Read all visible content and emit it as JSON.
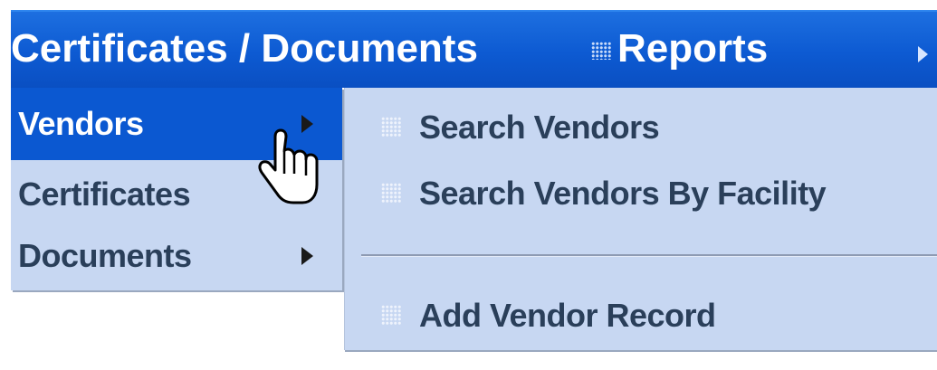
{
  "menubar": {
    "items": [
      {
        "label": "Certificates / Documents"
      },
      {
        "label": "Reports",
        "icon": "grip-icon"
      }
    ],
    "overflow_icon": "arrow-next-icon",
    "background_color": "#0b58d1",
    "text_color": "#ffffff"
  },
  "dropdown": {
    "items": [
      {
        "label": "Vendors",
        "selected": true,
        "has_submenu": true
      },
      {
        "label": "Certificates",
        "selected": false,
        "has_submenu": false
      },
      {
        "label": "Documents",
        "selected": false,
        "has_submenu": true
      }
    ],
    "background_color": "#c7d7f2",
    "selected_color": "#0b58d1"
  },
  "submenu": {
    "items": [
      {
        "label": "Search Vendors",
        "icon": "grip-icon"
      },
      {
        "label": "Search Vendors By Facility",
        "icon": "grip-icon"
      },
      {
        "label": "Add Vendor Record",
        "icon": "grip-icon"
      }
    ]
  },
  "cursor": {
    "icon": "hand-cursor-icon"
  }
}
